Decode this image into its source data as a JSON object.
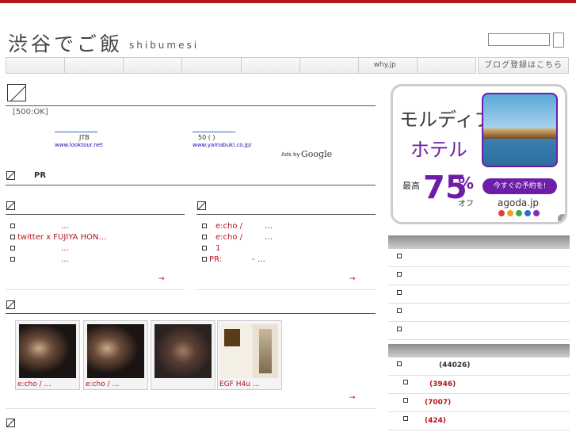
{
  "brand": {
    "accent": "#b3161a",
    "link": "#1a0dab"
  },
  "header": {
    "logo": "渋谷でご飯",
    "logo_sub": "shibumesi",
    "search_placeholder": ""
  },
  "nav": {
    "items": [
      "",
      "",
      "",
      "",
      "",
      "",
      "why.jp",
      ""
    ],
    "blog_register": "ブログ登録はこちら"
  },
  "main": {
    "status": "[500:OK]",
    "ads": [
      {
        "text": "JTB",
        "url": "www.looktour.net"
      },
      {
        "text": "50 ( )",
        "url": "www.yamabuki.co.jp/"
      }
    ],
    "ads_by": "Ads by",
    "google": "Google",
    "pr_label": "PR",
    "col_left": {
      "items": [
        {
          "text": "…"
        },
        {
          "text": "twitter x FUJIYA HON…"
        },
        {
          "text": "…"
        },
        {
          "text": "…"
        }
      ],
      "more": "→"
    },
    "col_right": {
      "items": [
        {
          "a": "e:cho /",
          "b": "…"
        },
        {
          "a": "e:cho /",
          "b": "…"
        },
        {
          "a": "1",
          "b": ""
        },
        {
          "a": "PR:",
          "b": "- …"
        }
      ],
      "more": "→"
    },
    "gallery": {
      "items": [
        {
          "caption": "e:cho /      …"
        },
        {
          "caption": "e:cho /      …"
        },
        {
          "caption": ""
        },
        {
          "caption": "EGF    H4u      …"
        }
      ],
      "more": "→"
    }
  },
  "sidebar": {
    "agoda": {
      "line1": "モルディブ",
      "line2": "ホテル",
      "max_label": "最高",
      "percent_num": "75",
      "percent_sign": "%",
      "off": "オフ",
      "cta": "今すぐの予約を!",
      "brand": "agoda.jp",
      "corner": "i"
    },
    "counts": [
      {
        "value": "(44026)"
      },
      {
        "value": "(3946)"
      },
      {
        "value": "(7007)"
      },
      {
        "value": "(424)"
      }
    ]
  }
}
